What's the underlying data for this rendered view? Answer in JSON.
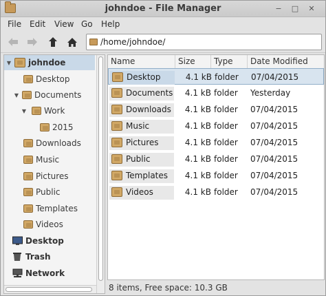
{
  "window": {
    "title": "johndoe - File Manager"
  },
  "menubar": {
    "file": "File",
    "edit": "Edit",
    "view": "View",
    "go": "Go",
    "help": "Help"
  },
  "toolbar": {
    "location": "/home/johndoe/",
    "icons": [
      "back-arrow",
      "forward-arrow",
      "up-arrow",
      "home"
    ]
  },
  "sidebar": {
    "items": [
      {
        "label": "johndoe",
        "level": 0,
        "expander": "▼",
        "bold": true
      },
      {
        "label": "Desktop",
        "level": 1,
        "expander": ""
      },
      {
        "label": "Documents",
        "level": 1,
        "expander": "▼"
      },
      {
        "label": "Work",
        "level": 2,
        "expander": "▼"
      },
      {
        "label": "2015",
        "level": 3,
        "expander": ""
      },
      {
        "label": "Downloads",
        "level": 1,
        "expander": ""
      },
      {
        "label": "Music",
        "level": 1,
        "expander": ""
      },
      {
        "label": "Pictures",
        "level": 1,
        "expander": ""
      },
      {
        "label": "Public",
        "level": 1,
        "expander": ""
      },
      {
        "label": "Templates",
        "level": 1,
        "expander": ""
      },
      {
        "label": "Videos",
        "level": 1,
        "expander": ""
      },
      {
        "label": "Desktop",
        "level": 0,
        "bold": true
      },
      {
        "label": "Trash",
        "level": 0,
        "bold": true
      },
      {
        "label": "Network",
        "level": 0,
        "bold": true
      }
    ]
  },
  "filelist": {
    "columns": {
      "name": "Name",
      "size": "Size",
      "type": "Type",
      "date": "Date Modified"
    },
    "rows": [
      {
        "name": "Desktop",
        "size": "4.1 kB",
        "type": "folder",
        "date": "07/04/2015"
      },
      {
        "name": "Documents",
        "size": "4.1 kB",
        "type": "folder",
        "date": "Yesterday"
      },
      {
        "name": "Downloads",
        "size": "4.1 kB",
        "type": "folder",
        "date": "07/04/2015"
      },
      {
        "name": "Music",
        "size": "4.1 kB",
        "type": "folder",
        "date": "07/04/2015"
      },
      {
        "name": "Pictures",
        "size": "4.1 kB",
        "type": "folder",
        "date": "07/04/2015"
      },
      {
        "name": "Public",
        "size": "4.1 kB",
        "type": "folder",
        "date": "07/04/2015"
      },
      {
        "name": "Templates",
        "size": "4.1 kB",
        "type": "folder",
        "date": "07/04/2015"
      },
      {
        "name": "Videos",
        "size": "4.1 kB",
        "type": "folder",
        "date": "07/04/2015"
      }
    ]
  },
  "status": {
    "text": "8 items, Free space: 10.3 GB"
  },
  "colors": {
    "accent": "#c9d9e8",
    "folder": "#d1a866"
  }
}
